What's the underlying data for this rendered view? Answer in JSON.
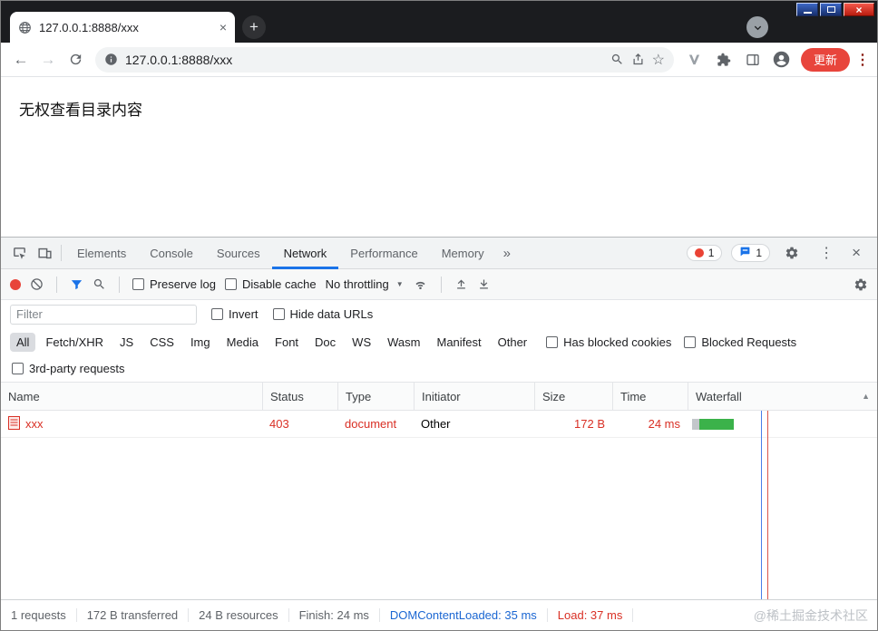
{
  "window_controls": {
    "minimize": "minimize",
    "maximize": "maximize",
    "close_glyph": "×"
  },
  "icons": {
    "back": "←",
    "forward": "→",
    "star": "☆",
    "kebab": "⋮",
    "more": "»",
    "dropdown": "▼",
    "sort_up": "▲",
    "close": "×",
    "new_tab": "+"
  },
  "browser_tab": {
    "title": "127.0.0.1:8888/xxx"
  },
  "toolbar": {
    "url": "127.0.0.1:8888/xxx",
    "update_label": "更新"
  },
  "page": {
    "message": "无权查看目录内容"
  },
  "devtools": {
    "tabs": [
      {
        "label": "Elements"
      },
      {
        "label": "Console"
      },
      {
        "label": "Sources"
      },
      {
        "label": "Network"
      },
      {
        "label": "Performance"
      },
      {
        "label": "Memory"
      }
    ],
    "error_badge": "1",
    "issue_badge": "1",
    "network": {
      "preserve_log": "Preserve log",
      "disable_cache": "Disable cache",
      "throttling": "No throttling",
      "filter_placeholder": "Filter",
      "invert": "Invert",
      "hide_data_urls": "Hide data URLs",
      "types": [
        "All",
        "Fetch/XHR",
        "JS",
        "CSS",
        "Img",
        "Media",
        "Font",
        "Doc",
        "WS",
        "Wasm",
        "Manifest",
        "Other"
      ],
      "has_blocked_cookies": "Has blocked cookies",
      "blocked_requests": "Blocked Requests",
      "third_party": "3rd-party requests",
      "columns": [
        "Name",
        "Status",
        "Type",
        "Initiator",
        "Size",
        "Time",
        "Waterfall"
      ],
      "rows": [
        {
          "name": "xxx",
          "status": "403",
          "type": "document",
          "initiator": "Other",
          "size": "172 B",
          "time": "24 ms"
        }
      ],
      "summary": [
        "1 requests",
        "172 B transferred",
        "24 B resources",
        "Finish: 24 ms",
        "DOMContentLoaded: 35 ms",
        "Load: 37 ms"
      ]
    }
  },
  "watermark": "@稀土掘金技术社区",
  "colors": {
    "accent": "#1a73e8",
    "error": "#d93025",
    "update_button": "#e8453c",
    "waterfall_green": "#3bb24a"
  }
}
